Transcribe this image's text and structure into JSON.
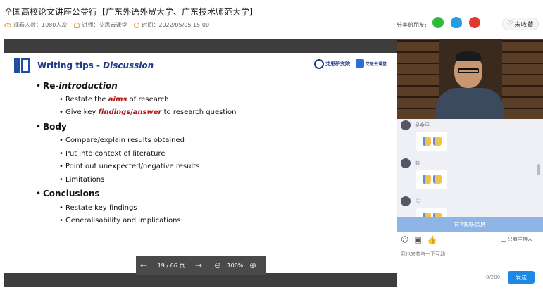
{
  "header": {
    "title": "全国高校论文讲座公益行【广东外语外贸大学、广东技术师范大学】",
    "views": "观看人数：1080人次",
    "lecturer": "讲师：艾思云课堂",
    "time": "时间：2022/05/05 15:00",
    "share_label": "分享给朋友:",
    "favorite_label": "未收藏"
  },
  "slide": {
    "title_prefix": "Writing tips - ",
    "title_em": "Discussion",
    "logo1_text": "艾思研究院",
    "logo2_text": "艾思云课堂",
    "sections": [
      {
        "head_a": "Re-",
        "head_b": "introduction",
        "items": [
          {
            "a": "Restate the ",
            "b": "aims",
            "c": " of research"
          },
          {
            "a": "Give key ",
            "b": "findings",
            "mid": "/",
            "b2": "answer",
            "c": " to research question"
          }
        ]
      },
      {
        "head": "Body",
        "items": [
          "Compare/explain results obtained",
          "Put into context of literature",
          "Point out unexpected/negative results",
          "Limitations"
        ]
      },
      {
        "head": "Conclusions",
        "items": [
          "Restate key findings",
          "Generalisability and implications"
        ]
      }
    ]
  },
  "pager": {
    "page": "19 / 66 页",
    "zoom": "100%"
  },
  "chat": {
    "users": [
      "吴金平",
      "燚",
      "🗨"
    ],
    "new_messages": "有7条新信息",
    "only_host": "只看主持人",
    "input_placeholder": "我也来参与一下互动",
    "char_count": "0/200",
    "send_label": "发送"
  },
  "colors": {
    "accent": "#1e88e5",
    "slide_title": "#1f3a8a",
    "highlight_red": "#b01515"
  }
}
